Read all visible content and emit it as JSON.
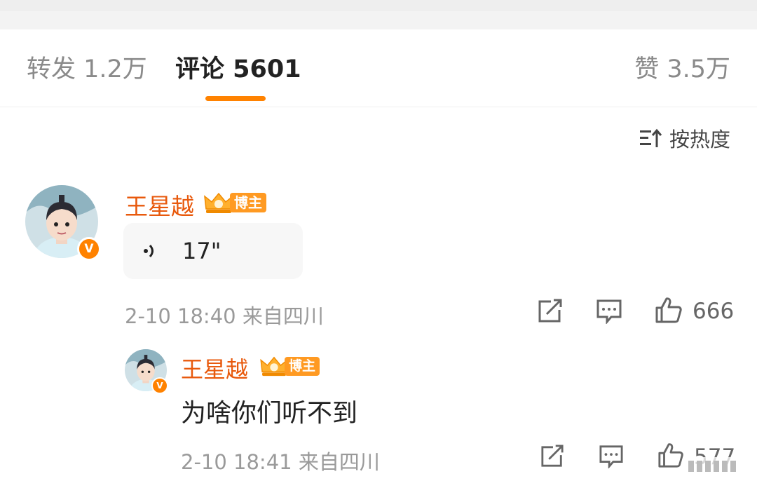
{
  "tabs": {
    "repost_label": "转发 1.2万",
    "comment_label": "评论 5601",
    "like_label": "赞 3.5万"
  },
  "sort": {
    "label": "按热度",
    "icon": "sort-icon"
  },
  "colors": {
    "accent": "#ff8200",
    "username": "#e8590c",
    "badge": "#ff9a22"
  },
  "comment": {
    "username": "王星越",
    "badge": "博主",
    "verified_mark": "V",
    "voice_duration": "17\"",
    "meta": "2-10 18:40 来自四川",
    "like_count": "666"
  },
  "reply": {
    "username": "王星越",
    "badge": "博主",
    "verified_mark": "V",
    "text": "为啥你们听不到",
    "meta": "2-10 18:41 来自四川",
    "like_count": "577"
  }
}
